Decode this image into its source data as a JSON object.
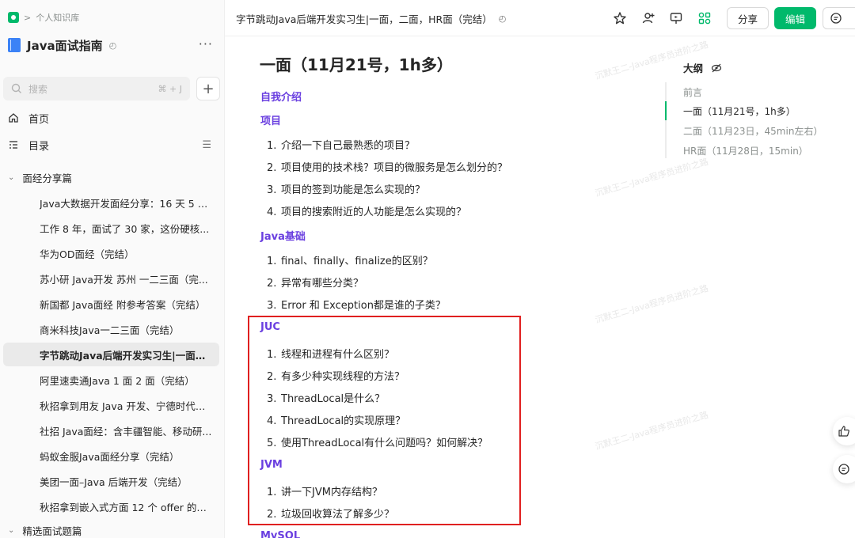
{
  "sidebar": {
    "breadcrumb": "个人知识库",
    "kb_title": "Java面试指南",
    "search_placeholder": "搜索",
    "search_shortcut": "⌘ + J",
    "nav": {
      "home": "首页",
      "toc": "目录"
    },
    "group1": "面经分享篇",
    "docs": [
      "Java大数据开发面经分享：16 天 5 面...",
      "工作 8 年，面试了 30 家，这份硬核...",
      "华为OD面经（完结）",
      "苏小研 Java开发 苏州 一二三面（完...",
      "新国都 Java面经 附参考答案（完结）",
      "商米科技Java一二三面（完结）",
      "字节跳动Java后端开发实习生|一面，...",
      "阿里速卖通Java 1 面 2 面（完结）",
      "秋招拿到用友 Java 开发、宁德时代测...",
      "社招 Java面经：含丰疆智能、移动研...",
      "蚂蚁金服Java面经分享（完结）",
      "美团一面–Java 后端开发（完结）",
      "秋招拿到嵌入式方面 12 个 offer 的经..."
    ],
    "active_index": 6,
    "group2": "精选面试题篇"
  },
  "header": {
    "doc_title": "字节跳动Java后端开发实习生|一面，二面，HR面（完结）",
    "share_label": "分享",
    "edit_label": "编辑"
  },
  "content": {
    "h1": "一面（11月21号，1h多）",
    "sections": {
      "intro": "自我介绍",
      "project": "项目",
      "java_basic": "Java基础",
      "juc": "JUC",
      "jvm": "JVM",
      "mysql": "MySQL"
    },
    "project_items": [
      "介绍一下自己最熟悉的项目？",
      "项目使用的技术栈？项目的微服务是怎么划分的？",
      "项目的签到功能是怎么实现的？",
      "项目的搜索附近的人功能是怎么实现的？"
    ],
    "java_items": [
      "final、finally、finalize的区别？",
      "异常有哪些分类？",
      "Error 和 Exception都是谁的子类？"
    ],
    "juc_items": [
      "线程和进程有什么区别？",
      "有多少种实现线程的方法？",
      "ThreadLocal是什么？",
      "ThreadLocal的实现原理？",
      "使用ThreadLocal有什么问题吗？如何解决？"
    ],
    "jvm_items": [
      "讲一下JVM内存结构？",
      "垃圾回收算法了解多少？"
    ],
    "watermark": "沉默王二-Java程序员进阶之路"
  },
  "outline": {
    "title": "大纲",
    "items": [
      "前言",
      "一面（11月21号，1h多）",
      "二面（11月23日，45min左右）",
      "HR面（11月28日，15min）"
    ],
    "active_index": 1
  },
  "colors": {
    "accent": "#00b96b",
    "heading": "#6a3fe0",
    "highlight": "#e02020"
  }
}
